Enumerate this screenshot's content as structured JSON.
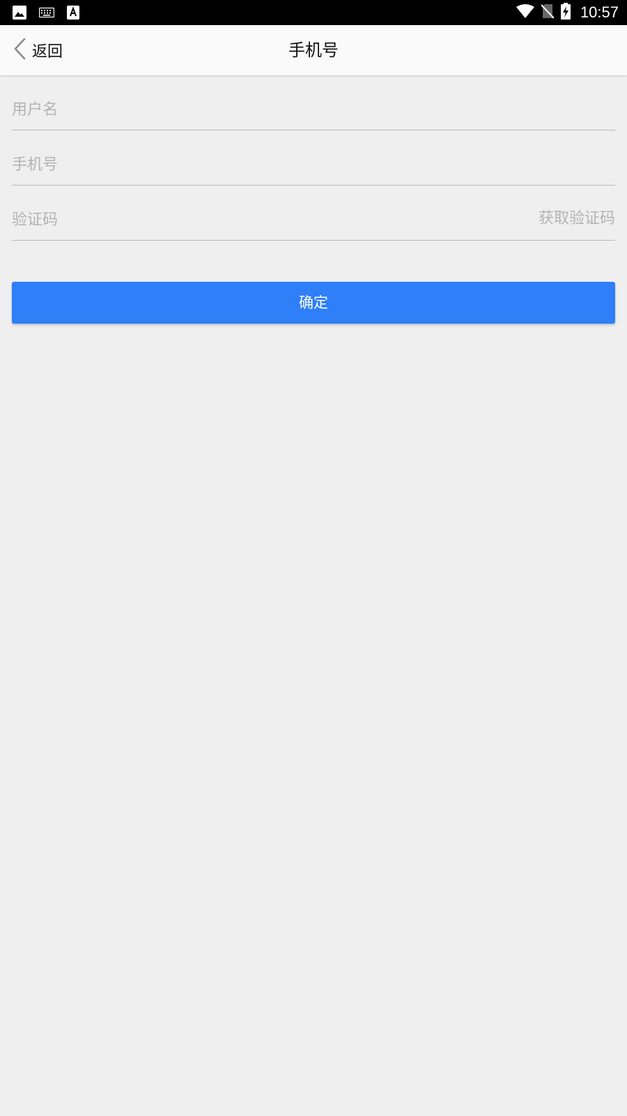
{
  "status_bar": {
    "time": "10:57",
    "left_icons": [
      "image-icon",
      "keyboard-icon",
      "font-download-icon"
    ],
    "right_icons": [
      "wifi-icon",
      "no-sim-icon",
      "battery-charging-icon"
    ]
  },
  "app_bar": {
    "back_label": "返回",
    "title": "手机号",
    "back_icon": "chevron-left-icon"
  },
  "form": {
    "username_placeholder": "用户名",
    "phone_placeholder": "手机号",
    "code_placeholder": "验证码",
    "get_code_label": "获取验证码",
    "username_value": "",
    "phone_value": "",
    "code_value": ""
  },
  "confirm_label": "确定",
  "colors": {
    "accent": "#2e7ff8",
    "background": "#efeff0",
    "app_bar": "#fafafa",
    "placeholder": "#b3b3b3",
    "divider": "#b9b9b9"
  }
}
